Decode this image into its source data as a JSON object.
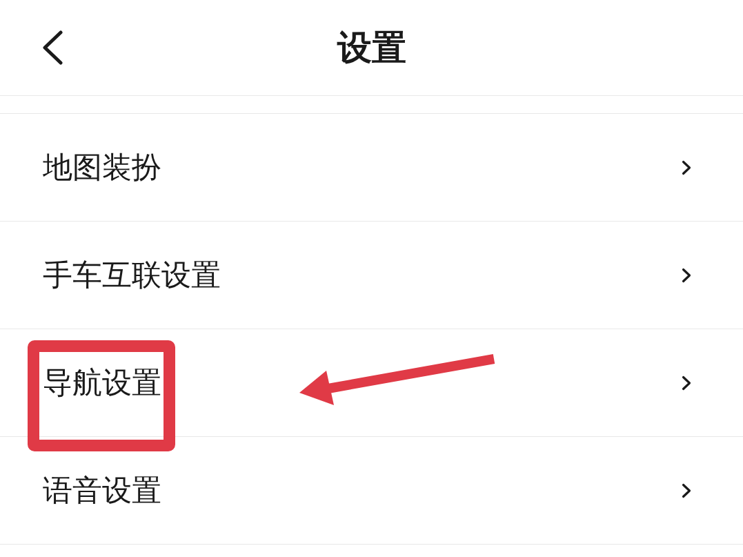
{
  "header": {
    "title": "设置"
  },
  "items": [
    {
      "label": "地图装扮",
      "highlighted": false
    },
    {
      "label": "手车互联设置",
      "highlighted": false
    },
    {
      "label": "导航设置",
      "highlighted": true
    },
    {
      "label": "语音设置",
      "highlighted": false
    }
  ]
}
